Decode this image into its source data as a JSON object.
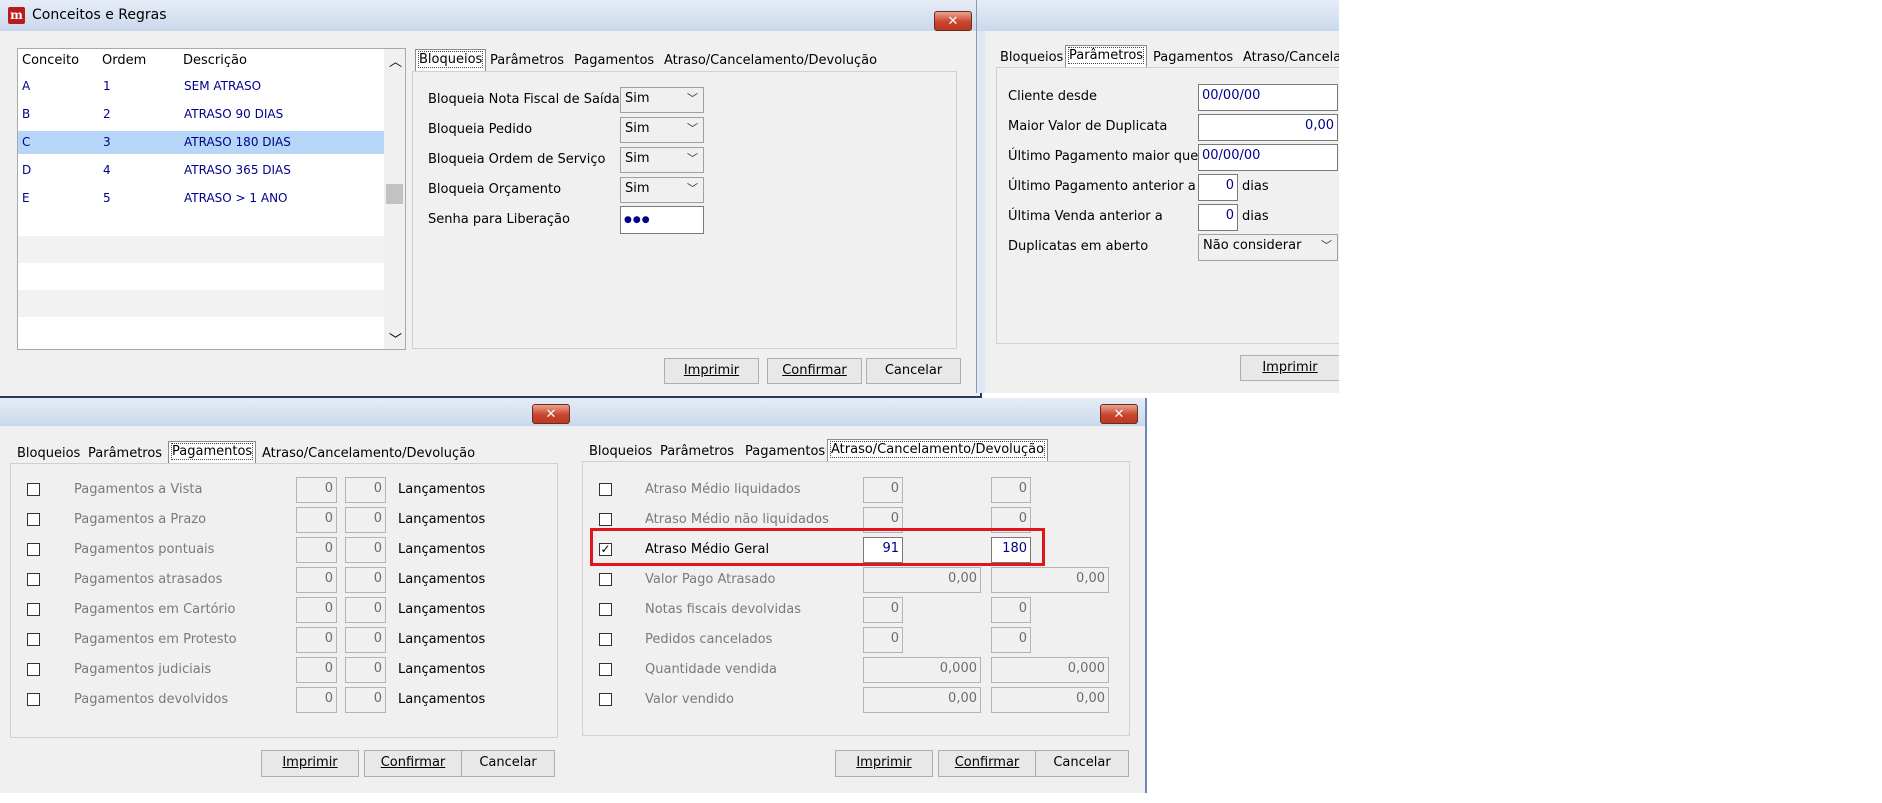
{
  "main_window": {
    "title": "Conceitos e Regras",
    "close_symbol": "✕",
    "grid": {
      "headers": [
        "Conceito",
        "Ordem",
        "Descrição"
      ],
      "rows": [
        {
          "conceito": "A",
          "ordem": "1",
          "descricao": "SEM ATRASO"
        },
        {
          "conceito": "B",
          "ordem": "2",
          "descricao": "ATRASO 90 DIAS"
        },
        {
          "conceito": "C",
          "ordem": "3",
          "descricao": "ATRASO 180 DIAS"
        },
        {
          "conceito": "D",
          "ordem": "4",
          "descricao": "ATRASO 365 DIAS"
        },
        {
          "conceito": "E",
          "ordem": "5",
          "descricao": "ATRASO > 1 ANO"
        }
      ],
      "selected_row": 2
    },
    "tabs": [
      "Bloqueios",
      "Parâmetros",
      "Pagamentos",
      "Atraso/Cancelamento/Devolução"
    ],
    "active_tab": "Bloqueios",
    "bloqueios": [
      {
        "label": "Bloqueia Nota Fiscal de Saída",
        "value": "Sim"
      },
      {
        "label": "Bloqueia Pedido",
        "value": "Sim"
      },
      {
        "label": "Bloqueia Ordem de Serviço",
        "value": "Sim"
      },
      {
        "label": "Bloqueia Orçamento",
        "value": "Sim"
      }
    ],
    "senha_label": "Senha para Liberação",
    "senha_value": "●●●",
    "buttons": {
      "imprimir": "Imprimir",
      "confirmar": "Confirmar",
      "cancelar": "Cancelar"
    }
  },
  "parametros_window": {
    "tabs": [
      "Bloqueios",
      "Parâmetros",
      "Pagamentos",
      "Atraso/Cancelar"
    ],
    "active_tab": "Parâmetros",
    "fields": {
      "cliente_desde": {
        "label": "Cliente desde",
        "value": "00/00/00"
      },
      "maior_valor": {
        "label": "Maior Valor de Duplicata",
        "value": "0,00"
      },
      "ultimo_pag_maior": {
        "label": "Último Pagamento maior que",
        "value": "00/00/00"
      },
      "ultimo_pag_anterior": {
        "label": "Último Pagamento anterior a",
        "value": "0",
        "unit": "dias"
      },
      "ultima_venda": {
        "label": "Última Venda anterior a",
        "value": "0",
        "unit": "dias"
      },
      "duplicatas": {
        "label": "Duplicatas em aberto",
        "value": "Não considerar"
      }
    },
    "buttons": {
      "imprimir": "Imprimir"
    }
  },
  "pagamentos_window": {
    "close_symbol": "✕",
    "tabs": [
      "Bloqueios",
      "Parâmetros",
      "Pagamentos",
      "Atraso/Cancelamento/Devolução"
    ],
    "active_tab": "Pagamentos",
    "unit_label": "Lançamentos",
    "rows": [
      {
        "label": "Pagamentos a Vista",
        "a": "0",
        "b": "0"
      },
      {
        "label": "Pagamentos a Prazo",
        "a": "0",
        "b": "0"
      },
      {
        "label": "Pagamentos pontuais",
        "a": "0",
        "b": "0"
      },
      {
        "label": "Pagamentos atrasados",
        "a": "0",
        "b": "0"
      },
      {
        "label": "Pagamentos em Cartório",
        "a": "0",
        "b": "0"
      },
      {
        "label": "Pagamentos em Protesto",
        "a": "0",
        "b": "0"
      },
      {
        "label": "Pagamentos judiciais",
        "a": "0",
        "b": "0"
      },
      {
        "label": "Pagamentos devolvidos",
        "a": "0",
        "b": "0"
      }
    ],
    "buttons": {
      "imprimir": "Imprimir",
      "confirmar": "Confirmar",
      "cancelar": "Cancelar"
    }
  },
  "atraso_window": {
    "close_symbol": "✕",
    "tabs": [
      "Bloqueios",
      "Parâmetros",
      "Pagamentos",
      "Atraso/Cancelamento/Devolução"
    ],
    "active_tab": "Atraso/Cancelamento/Devolução",
    "rows": [
      {
        "label": "Atraso Médio liquidados",
        "a": "0",
        "b": "0",
        "checked": false
      },
      {
        "label": "Atraso Médio não liquidados",
        "a": "0",
        "b": "0",
        "checked": false
      },
      {
        "label": "Atraso Médio Geral",
        "a": "91",
        "b": "180",
        "checked": true
      },
      {
        "label": "Valor Pago Atrasado",
        "a": "0,00",
        "b": "0,00",
        "checked": false
      },
      {
        "label": "Notas fiscais devolvidas",
        "a": "0",
        "b": "0",
        "checked": false
      },
      {
        "label": "Pedidos cancelados",
        "a": "0",
        "b": "0",
        "checked": false
      },
      {
        "label": "Quantidade vendida",
        "a": "0,000",
        "b": "0,000",
        "checked": false
      },
      {
        "label": "Valor vendido",
        "a": "0,00",
        "b": "0,00",
        "checked": false
      }
    ],
    "check_mark": "✓",
    "buttons": {
      "imprimir": "Imprimir",
      "confirmar": "Confirmar",
      "cancelar": "Cancelar"
    }
  }
}
